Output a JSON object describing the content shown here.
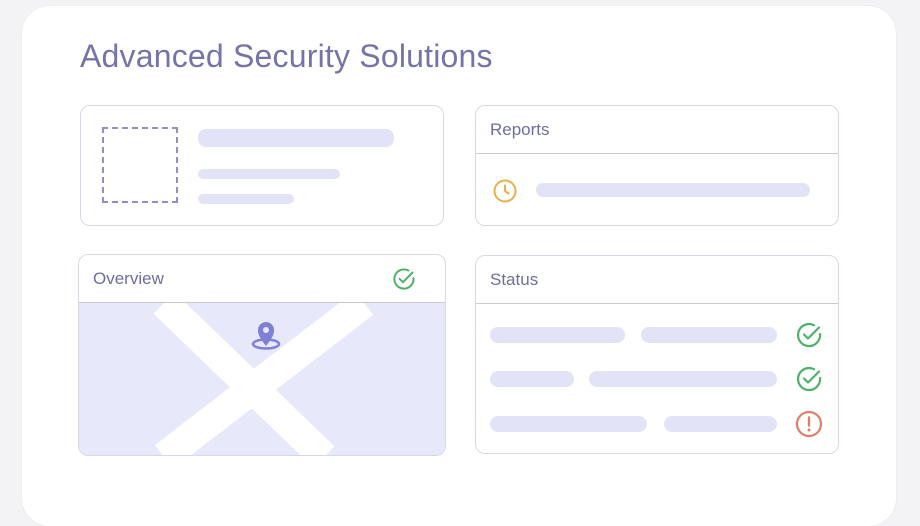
{
  "title": "Advanced Security Solutions",
  "reports": {
    "label": "Reports",
    "icon": "clock-icon",
    "icon_color": "#e8b04a"
  },
  "overview": {
    "label": "Overview",
    "header_icon": "check-circle-icon",
    "map_icon": "location-pin-icon"
  },
  "status": {
    "label": "Status",
    "rows": [
      {
        "state": "success",
        "icon": "check-circle-icon"
      },
      {
        "state": "success",
        "icon": "check-circle-icon"
      },
      {
        "state": "warning",
        "icon": "alert-circle-icon"
      }
    ]
  },
  "colors": {
    "title": "#7474a8",
    "placeholder": "#e3e3f8",
    "map_bg": "#e8e8fb",
    "success": "#4fb06a",
    "warning": "#d9806a",
    "accent": "#7f7fd6"
  }
}
